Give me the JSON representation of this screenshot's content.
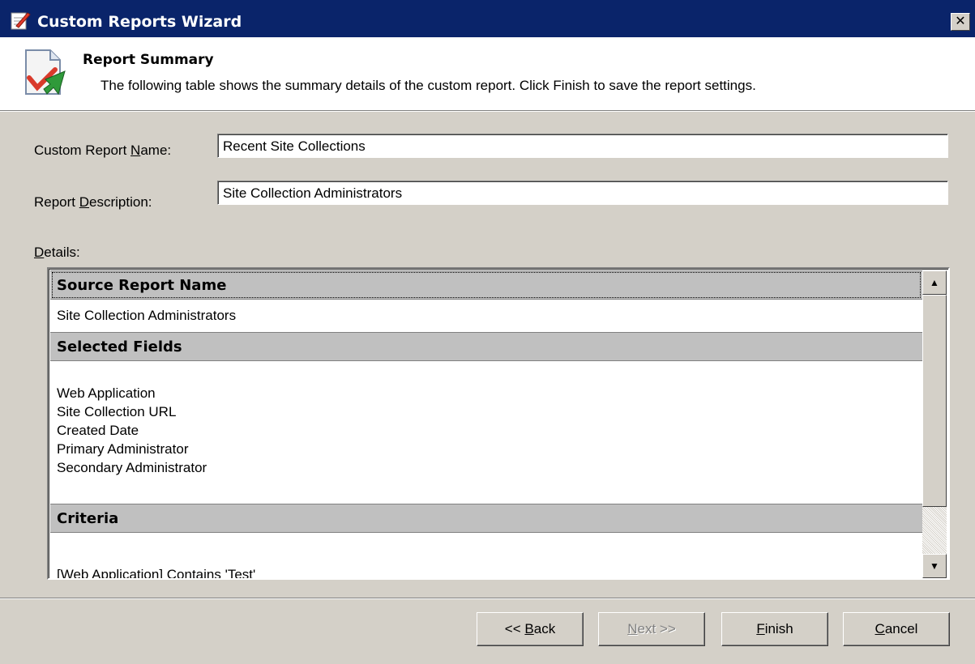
{
  "window": {
    "title": "Custom Reports Wizard",
    "close_glyph": "✕"
  },
  "header": {
    "title": "Report Summary",
    "description": "The following table shows the summary details of the custom report. Click Finish to save the report settings."
  },
  "form": {
    "name_label_pre": "Custom Report ",
    "name_label_key": "N",
    "name_label_post": "ame:",
    "name_value": "Recent Site Collections",
    "desc_label_pre": "Report ",
    "desc_label_key": "D",
    "desc_label_post": "escription:",
    "desc_value": "Site Collection Administrators",
    "details_label_key": "D",
    "details_label_post": "etails:"
  },
  "details": {
    "source_header": "Source Report Name",
    "source_value": "Site Collection Administrators",
    "fields_header": "Selected Fields",
    "fields": [
      "Web Application",
      "Site Collection URL",
      "Created Date",
      "Primary Administrator",
      "Secondary Administrator"
    ],
    "criteria_header": "Criteria",
    "criteria_value": "[Web Application] Contains 'Test'"
  },
  "buttons": {
    "back_pre": "<< ",
    "back_key": "B",
    "back_post": "ack",
    "next_key": "N",
    "next_post": "ext >>",
    "finish_key": "F",
    "finish_post": "inish",
    "cancel_key": "C",
    "cancel_post": "ancel"
  },
  "icons": {
    "app": "notepad-check-icon",
    "header": "report-checkmark-icon",
    "scroll_up": "▲",
    "scroll_down": "▼"
  }
}
